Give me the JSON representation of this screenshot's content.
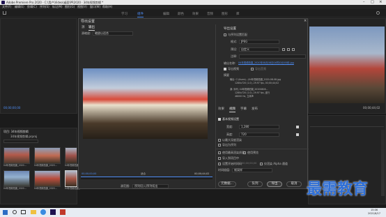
{
  "app": {
    "title": "Adobe Premiere Pro 2020 - C:\\用户\\Video\\桌面\\PR2020 · 34年视频剪辑 *",
    "menus": [
      "文件(F)",
      "编辑(E)",
      "剪辑(C)",
      "序列(S)",
      "标记(M)",
      "图形(G)",
      "视图(V)",
      "窗口(W)",
      "帮助(H)"
    ],
    "workspace_tabs": [
      "学习",
      "组件",
      "编辑",
      "颜色",
      "效果",
      "音频",
      "图形",
      "库"
    ],
    "active_tab": "组件"
  },
  "left_panel": {
    "timecode": "00;00;00;00",
    "project_name": "项目: 34年视频剪辑",
    "project_file": "34年视频剪辑.prproj",
    "clips": [
      {
        "name": "04年视频拍摄_2020..."
      },
      {
        "name": "04年视频拍摄_2020..."
      },
      {
        "name": "04年视频拍摄_2020..."
      },
      {
        "name": "04年视频拍摄_2020..."
      },
      {
        "name": "04年视频拍摄_2020..."
      },
      {
        "name": "04年视频拍摄_2020..."
      }
    ]
  },
  "right_monitor": {
    "timecode": "00;00;44;02"
  },
  "dialog": {
    "title": "导出设置",
    "left_tabs": [
      "源",
      "输出"
    ],
    "active_left_tab": "输出",
    "source_scaling_label": "源缩放:",
    "source_scaling_value": "缩放以适合",
    "timecode_in": "00;00;00;00",
    "timecode_out": "00;00;44;02",
    "fit_label": "适合",
    "source_range_label": "源范围:",
    "source_range_value": "序列切入/序列切出",
    "export_settings": {
      "section_title": "导出设置",
      "match_sequence_label": "与序列设置匹配",
      "format_label": "格式:",
      "format_value": "JPEG",
      "preset_label": "预设:",
      "preset_value": "自定义",
      "comment_label": "注释:",
      "comment_value": "",
      "output_name_label": "输出名称:",
      "output_name_value": "04年视频拍摄_2020年08月08日04时03分05秒.jpg",
      "export_video_label": "导出视频",
      "export_audio_label": "导出音频",
      "summary_title": "摘要",
      "summary_output": "输出: C:\\Users\\...\\04年视频拍摄_2020-08-08.jpg",
      "summary_output_detail": "1280x720 (1.0), 29.97 fps, 00;00;44;02",
      "summary_source": "源: 序列, 04年视频拍摄_20200808...",
      "summary_source_detail": "1280x720 (1.0), 29.97 fps, 逐行",
      "summary_source_detail2": "48000 Hz, 立体声"
    },
    "settings_tabs": [
      "效果",
      "视频",
      "字幕",
      "发布"
    ],
    "active_settings_tab": "视频",
    "video_section": {
      "basic_video_settings": "基本视频设置",
      "width_label": "宽度:",
      "width_value": "1,280",
      "height_label": "高度:",
      "height_value": "720",
      "render_max_depth": "以最大深度渲染",
      "export_as_sequence": "导出为序列"
    },
    "bottom_options": {
      "use_max_render_quality": "使用最高渲染质量",
      "use_previews": "使用预览",
      "import_into_project": "导入到项目中",
      "set_start_timecode": "设置开始时间码",
      "start_timecode_value": "00;00;00;00",
      "render_alpha_only": "仅渲染 Alpha 通道",
      "time_interpolation_label": "时间插值:",
      "time_interpolation_value": "帧采样"
    },
    "buttons": {
      "metadata": "元数据...",
      "queue": "队列",
      "export": "导出",
      "cancel": "取消"
    }
  },
  "watermark": {
    "text": "最需教育"
  },
  "taskbar": {
    "time": "15:06",
    "date": "2021/8/17"
  }
}
